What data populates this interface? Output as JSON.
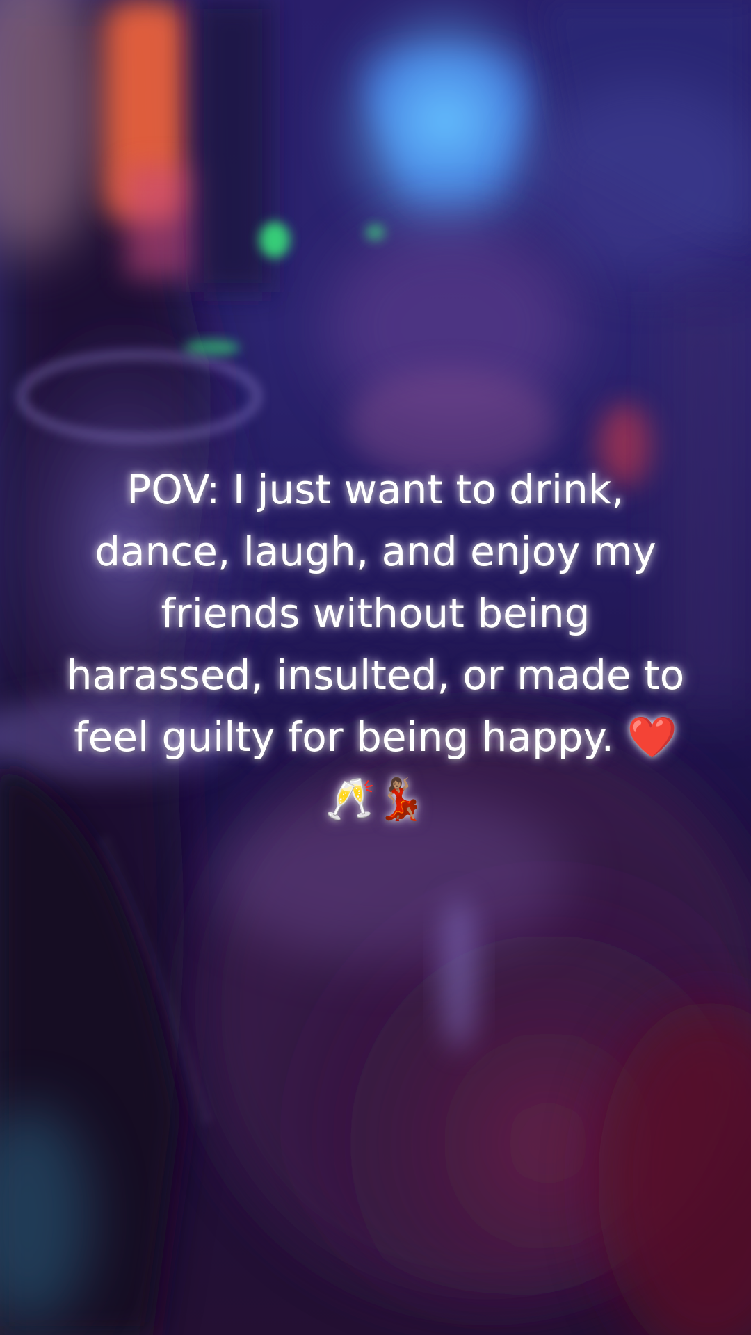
{
  "overlay": {
    "caption": "POV: I just want to drink, dance, laugh, and enjoy my friends without being harassed, insulted, or made to feel guilty for being happy. ❤️🥂💃🏽"
  },
  "scene": {
    "description_colors": {
      "ambient_purple": "#2a1f6b",
      "neon_blue": "#5fb8ff",
      "neon_red": "#ff5a3a",
      "neon_green": "#38e07a",
      "deep_magenta": "#3a0f2a"
    }
  }
}
